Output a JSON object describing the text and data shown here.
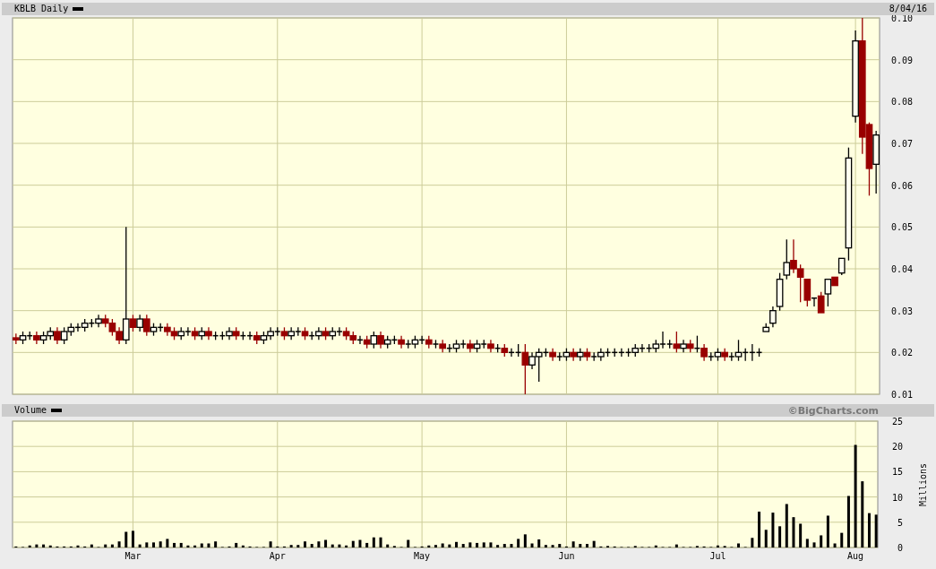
{
  "price_panel": {
    "title": "KBLB Daily",
    "date": "8/04/16",
    "chart_data": {
      "type": "candlestick",
      "grid": true,
      "ylim": [
        0.01,
        0.1
      ],
      "yticks": [
        {
          "value": 0.1,
          "label": "0.10"
        },
        {
          "value": 0.09,
          "label": "0.09"
        },
        {
          "value": 0.08,
          "label": "0.08"
        },
        {
          "value": 0.07,
          "label": "0.07"
        },
        {
          "value": 0.06,
          "label": "0.06"
        },
        {
          "value": 0.05,
          "label": "0.05"
        },
        {
          "value": 0.04,
          "label": "0.04"
        },
        {
          "value": 0.03,
          "label": "0.03"
        },
        {
          "value": 0.02,
          "label": "0.02"
        },
        {
          "value": 0.01,
          "label": "0.01"
        }
      ],
      "categories": [
        null,
        null,
        null,
        null,
        null,
        null,
        null,
        null,
        null,
        null,
        null,
        null,
        null,
        null,
        null,
        null,
        null,
        null,
        null,
        null,
        null,
        null,
        null,
        null,
        null,
        null,
        null,
        null,
        null,
        null,
        null,
        null,
        null,
        null,
        null,
        null,
        null,
        null,
        null,
        null,
        null,
        null,
        null,
        null,
        null,
        null,
        null,
        null,
        null,
        null,
        null,
        null,
        null,
        null,
        null,
        null,
        null,
        null,
        null,
        null,
        null,
        null,
        null,
        null,
        null,
        null,
        null,
        null,
        null,
        null,
        null,
        null,
        null,
        null,
        null,
        null,
        null,
        null,
        null,
        null,
        null,
        null,
        null,
        null,
        null,
        null,
        null,
        null,
        null,
        null,
        null,
        null,
        null,
        null,
        null,
        null,
        null,
        null,
        null,
        null,
        null,
        null,
        null,
        null,
        null,
        null,
        null,
        null,
        null,
        null,
        null,
        null,
        null,
        null,
        null,
        null,
        null,
        null,
        null,
        null,
        null,
        null,
        null,
        null,
        null,
        null
      ],
      "ohlc": [
        [
          0.0235,
          0.0245,
          0.022,
          0.023
        ],
        [
          0.023,
          0.025,
          0.022,
          0.024
        ],
        [
          0.024,
          0.025,
          0.023,
          0.024
        ],
        [
          0.024,
          0.025,
          0.022,
          0.023
        ],
        [
          0.023,
          0.025,
          0.022,
          0.024
        ],
        [
          0.024,
          0.026,
          0.023,
          0.025
        ],
        [
          0.025,
          0.026,
          0.022,
          0.023
        ],
        [
          0.023,
          0.026,
          0.022,
          0.025
        ],
        [
          0.025,
          0.027,
          0.024,
          0.026
        ],
        [
          0.026,
          0.027,
          0.025,
          0.026
        ],
        [
          0.026,
          0.028,
          0.025,
          0.027
        ],
        [
          0.027,
          0.028,
          0.026,
          0.027
        ],
        [
          0.027,
          0.029,
          0.026,
          0.028
        ],
        [
          0.028,
          0.029,
          0.026,
          0.027
        ],
        [
          0.027,
          0.028,
          0.024,
          0.025
        ],
        [
          0.025,
          0.026,
          0.022,
          0.023
        ],
        [
          0.023,
          0.05,
          0.022,
          0.028
        ],
        [
          0.028,
          0.029,
          0.025,
          0.026
        ],
        [
          0.026,
          0.029,
          0.025,
          0.028
        ],
        [
          0.028,
          0.029,
          0.024,
          0.025
        ],
        [
          0.025,
          0.027,
          0.024,
          0.026
        ],
        [
          0.026,
          0.027,
          0.025,
          0.026
        ],
        [
          0.026,
          0.027,
          0.024,
          0.025
        ],
        [
          0.025,
          0.026,
          0.023,
          0.024
        ],
        [
          0.024,
          0.026,
          0.023,
          0.025
        ],
        [
          0.025,
          0.026,
          0.024,
          0.025
        ],
        [
          0.025,
          0.026,
          0.023,
          0.024
        ],
        [
          0.024,
          0.026,
          0.023,
          0.025
        ],
        [
          0.025,
          0.026,
          0.023,
          0.024
        ],
        [
          0.024,
          0.025,
          0.023,
          0.024
        ],
        [
          0.024,
          0.025,
          0.023,
          0.024
        ],
        [
          0.024,
          0.026,
          0.023,
          0.025
        ],
        [
          0.025,
          0.026,
          0.023,
          0.024
        ],
        [
          0.024,
          0.025,
          0.023,
          0.024
        ],
        [
          0.024,
          0.025,
          0.023,
          0.024
        ],
        [
          0.024,
          0.025,
          0.022,
          0.023
        ],
        [
          0.023,
          0.025,
          0.022,
          0.024
        ],
        [
          0.024,
          0.026,
          0.023,
          0.025
        ],
        [
          0.025,
          0.026,
          0.024,
          0.025
        ],
        [
          0.025,
          0.026,
          0.023,
          0.024
        ],
        [
          0.024,
          0.026,
          0.023,
          0.025
        ],
        [
          0.025,
          0.026,
          0.024,
          0.025
        ],
        [
          0.025,
          0.026,
          0.023,
          0.024
        ],
        [
          0.024,
          0.025,
          0.023,
          0.024
        ],
        [
          0.024,
          0.026,
          0.023,
          0.025
        ],
        [
          0.025,
          0.026,
          0.023,
          0.024
        ],
        [
          0.024,
          0.026,
          0.023,
          0.025
        ],
        [
          0.025,
          0.026,
          0.024,
          0.025
        ],
        [
          0.025,
          0.026,
          0.023,
          0.024
        ],
        [
          0.024,
          0.025,
          0.022,
          0.023
        ],
        [
          0.023,
          0.024,
          0.022,
          0.023
        ],
        [
          0.023,
          0.024,
          0.021,
          0.022
        ],
        [
          0.022,
          0.025,
          0.021,
          0.024
        ],
        [
          0.024,
          0.025,
          0.021,
          0.022
        ],
        [
          0.022,
          0.024,
          0.021,
          0.023
        ],
        [
          0.023,
          0.024,
          0.022,
          0.023
        ],
        [
          0.023,
          0.024,
          0.021,
          0.022
        ],
        [
          0.022,
          0.023,
          0.021,
          0.022
        ],
        [
          0.022,
          0.024,
          0.021,
          0.023
        ],
        [
          0.023,
          0.024,
          0.022,
          0.023
        ],
        [
          0.023,
          0.024,
          0.021,
          0.022
        ],
        [
          0.022,
          0.023,
          0.021,
          0.022
        ],
        [
          0.022,
          0.023,
          0.02,
          0.021
        ],
        [
          0.021,
          0.022,
          0.02,
          0.021
        ],
        [
          0.021,
          0.023,
          0.02,
          0.022
        ],
        [
          0.022,
          0.023,
          0.021,
          0.022
        ],
        [
          0.022,
          0.023,
          0.02,
          0.021
        ],
        [
          0.021,
          0.023,
          0.02,
          0.022
        ],
        [
          0.022,
          0.023,
          0.021,
          0.022
        ],
        [
          0.022,
          0.023,
          0.02,
          0.021
        ],
        [
          0.021,
          0.022,
          0.02,
          0.021
        ],
        [
          0.021,
          0.022,
          0.019,
          0.02
        ],
        [
          0.02,
          0.021,
          0.019,
          0.02
        ],
        [
          0.02,
          0.022,
          0.019,
          0.02
        ],
        [
          0.02,
          0.022,
          0.01,
          0.017
        ],
        [
          0.017,
          0.02,
          0.016,
          0.019
        ],
        [
          0.019,
          0.021,
          0.013,
          0.02
        ],
        [
          0.02,
          0.021,
          0.019,
          0.02
        ],
        [
          0.02,
          0.021,
          0.018,
          0.019
        ],
        [
          0.019,
          0.02,
          0.018,
          0.019
        ],
        [
          0.019,
          0.021,
          0.018,
          0.02
        ],
        [
          0.02,
          0.021,
          0.018,
          0.019
        ],
        [
          0.019,
          0.021,
          0.018,
          0.02
        ],
        [
          0.02,
          0.021,
          0.018,
          0.019
        ],
        [
          0.019,
          0.02,
          0.018,
          0.019
        ],
        [
          0.019,
          0.021,
          0.018,
          0.02
        ],
        [
          0.02,
          0.021,
          0.019,
          0.02
        ],
        [
          0.02,
          0.021,
          0.019,
          0.02
        ],
        [
          0.02,
          0.021,
          0.019,
          0.02
        ],
        [
          0.02,
          0.021,
          0.019,
          0.02
        ],
        [
          0.02,
          0.022,
          0.019,
          0.021
        ],
        [
          0.021,
          0.022,
          0.02,
          0.021
        ],
        [
          0.021,
          0.022,
          0.02,
          0.021
        ],
        [
          0.021,
          0.023,
          0.02,
          0.022
        ],
        [
          0.022,
          0.025,
          0.021,
          0.022
        ],
        [
          0.022,
          0.023,
          0.021,
          0.022
        ],
        [
          0.022,
          0.025,
          0.02,
          0.021
        ],
        [
          0.021,
          0.023,
          0.02,
          0.022
        ],
        [
          0.022,
          0.023,
          0.02,
          0.021
        ],
        [
          0.021,
          0.024,
          0.02,
          0.021
        ],
        [
          0.021,
          0.022,
          0.018,
          0.019
        ],
        [
          0.019,
          0.02,
          0.018,
          0.019
        ],
        [
          0.019,
          0.021,
          0.018,
          0.02
        ],
        [
          0.02,
          0.021,
          0.018,
          0.019
        ],
        [
          0.019,
          0.02,
          0.018,
          0.019
        ],
        [
          0.019,
          0.023,
          0.018,
          0.02
        ],
        [
          0.02,
          0.021,
          0.018,
          0.02
        ],
        [
          0.02,
          0.022,
          0.018,
          0.02
        ],
        [
          0.02,
          0.021,
          0.019,
          0.02
        ],
        [
          0.025,
          0.027,
          0.025,
          0.026
        ],
        [
          0.027,
          0.031,
          0.026,
          0.03
        ],
        [
          0.031,
          0.039,
          0.03,
          0.0375
        ],
        [
          0.0385,
          0.047,
          0.0375,
          0.0415
        ],
        [
          0.042,
          0.047,
          0.039,
          0.04
        ],
        [
          0.04,
          0.041,
          0.032,
          0.038
        ],
        [
          0.0375,
          0.0375,
          0.031,
          0.0325
        ],
        [
          0.033,
          0.033,
          0.031,
          0.033
        ],
        [
          0.0335,
          0.0345,
          0.0295,
          0.0295
        ],
        [
          0.034,
          0.0375,
          0.031,
          0.0375
        ],
        [
          0.038,
          0.038,
          0.036,
          0.036
        ],
        [
          0.039,
          0.0425,
          0.0385,
          0.0425
        ],
        [
          0.045,
          0.069,
          0.042,
          0.0665
        ],
        [
          0.0765,
          0.097,
          0.075,
          0.0945
        ],
        [
          0.0945,
          0.1,
          0.0675,
          0.0715
        ],
        [
          0.0745,
          0.075,
          0.0575,
          0.064
        ],
        [
          0.065,
          0.073,
          0.058,
          0.072
        ]
      ]
    }
  },
  "volume_panel": {
    "title": "Volume",
    "credit": "©BigCharts.com",
    "chart_data": {
      "type": "bar",
      "grid": true,
      "ylabel": "Millions",
      "ylim": [
        0,
        25
      ],
      "yticks": [
        0,
        5,
        10,
        15,
        20,
        25
      ],
      "categories": [
        null,
        null,
        null,
        null,
        null,
        null,
        null,
        null,
        null,
        null,
        null,
        null,
        null,
        null,
        null,
        null,
        null,
        "Mar",
        null,
        null,
        null,
        null,
        null,
        null,
        null,
        null,
        null,
        null,
        null,
        null,
        null,
        null,
        null,
        null,
        null,
        null,
        null,
        null,
        "Apr",
        null,
        null,
        null,
        null,
        null,
        null,
        null,
        null,
        null,
        null,
        null,
        null,
        null,
        null,
        null,
        null,
        null,
        null,
        null,
        null,
        "May",
        null,
        null,
        null,
        null,
        null,
        null,
        null,
        null,
        null,
        null,
        null,
        null,
        null,
        null,
        null,
        null,
        null,
        null,
        null,
        null,
        "Jun",
        null,
        null,
        null,
        null,
        null,
        null,
        null,
        null,
        null,
        null,
        null,
        null,
        null,
        null,
        null,
        null,
        null,
        null,
        null,
        null,
        null,
        "Jul",
        null,
        null,
        null,
        null,
        null,
        null,
        null,
        null,
        null,
        null,
        null,
        null,
        null,
        null,
        null,
        null,
        null,
        null,
        null,
        "Aug",
        null,
        null,
        null
      ],
      "values": [
        0.2,
        0.1,
        0.4,
        0.6,
        0.6,
        0.4,
        0.2,
        0.2,
        0.2,
        0.4,
        0.2,
        0.6,
        0.1,
        0.6,
        0.6,
        1.2,
        3.1,
        3.3,
        0.6,
        1,
        1,
        1.2,
        1.7,
        0.9,
        0.9,
        0.4,
        0.4,
        0.8,
        0.8,
        1.2,
        0.1,
        0.2,
        0.9,
        0.4,
        0.2,
        0.1,
        0.1,
        1.2,
        0.2,
        0.2,
        0.5,
        0.5,
        1.2,
        0.7,
        1.2,
        1.5,
        0.6,
        0.6,
        0.4,
        1.3,
        1.5,
        0.9,
        2,
        2,
        0.6,
        0.3,
        0.1,
        1.5,
        0.1,
        0.2,
        0.4,
        0.5,
        0.8,
        0.6,
        1.1,
        0.7,
        1,
        0.9,
        1,
        1,
        0.5,
        0.7,
        0.7,
        1.7,
        2.6,
        0.8,
        1.6,
        0.5,
        0.5,
        0.7,
        0.2,
        1.2,
        0.7,
        0.7,
        1.3,
        0.2,
        0.3,
        0.2,
        0.1,
        0.1,
        0.3,
        0.1,
        0.1,
        0.4,
        0.1,
        0.1,
        0.6,
        0.1,
        0.1,
        0.3,
        0.2,
        0.1,
        0.4,
        0.3,
        0.1,
        0.8,
        0.1,
        1.9,
        7.1,
        3.5,
        6.9,
        4.2,
        8.6,
        6,
        4.7,
        1.7,
        1,
        2.4,
        6.3,
        0.8,
        2.9,
        10.2,
        20.3,
        13.1,
        6.8,
        6.5
      ]
    }
  }
}
